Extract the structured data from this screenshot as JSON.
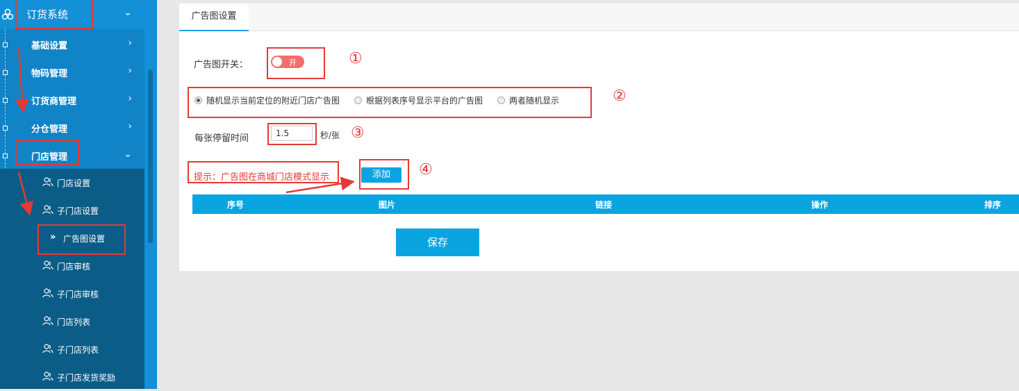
{
  "sidebar": {
    "top_label": "订货系统",
    "items": [
      {
        "label": "基础设置",
        "chev": "›"
      },
      {
        "label": "物码管理",
        "chev": "›"
      },
      {
        "label": "订货商管理",
        "chev": "›"
      },
      {
        "label": "分仓管理",
        "chev": "›"
      },
      {
        "label": "门店管理",
        "chev": "⌄"
      }
    ],
    "sub_items": [
      {
        "label": "门店设置",
        "icon": "users-icon"
      },
      {
        "label": "子门店设置",
        "icon": "users-icon"
      },
      {
        "label": "广告图设置",
        "icon": "double-chevron-icon",
        "active": true
      },
      {
        "label": "门店审核",
        "icon": "users-icon"
      },
      {
        "label": "子门店审核",
        "icon": "users-icon"
      },
      {
        "label": "门店列表",
        "icon": "users-icon"
      },
      {
        "label": "子门店列表",
        "icon": "users-icon"
      },
      {
        "label": "子门店发货奖励",
        "icon": "users-icon"
      }
    ]
  },
  "tab": {
    "label": "广告图设置"
  },
  "form": {
    "switch_label": "广告图开关：",
    "switch_text": "开",
    "radios": [
      {
        "label": "随机显示当前定位的附近门店广告图",
        "checked": true
      },
      {
        "label": "根据列表序号显示平台的广告图",
        "checked": false
      },
      {
        "label": "两者随机显示",
        "checked": false
      }
    ],
    "stay_label": "每张停留时间",
    "stay_value": "1.5",
    "stay_unit": "秒/张",
    "hint": "提示：广告图在商城门店模式显示",
    "add_label": "添加"
  },
  "table": {
    "headers": [
      "序号",
      "图片",
      "链接",
      "操作",
      "排序"
    ]
  },
  "save_label": "保存",
  "annotations": [
    "①",
    "②",
    "③",
    "④"
  ],
  "colors": {
    "accent": "#0aa5e1",
    "sidebar": "#1084c7",
    "sidebar_sub": "#0b5d87",
    "annotation": "#e53935",
    "switch_on": "#f56c6c"
  }
}
